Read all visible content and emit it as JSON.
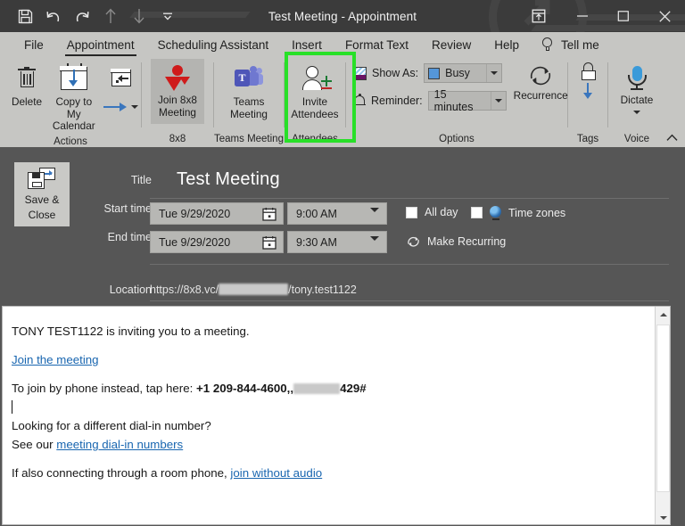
{
  "window": {
    "title": "Test Meeting  -  Appointment",
    "quick_access": [
      {
        "name": "save",
        "icon": "save-icon",
        "enabled": true
      },
      {
        "name": "undo",
        "icon": "undo-icon",
        "enabled": true
      },
      {
        "name": "redo",
        "icon": "redo-icon",
        "enabled": true
      },
      {
        "name": "previous-item",
        "icon": "up-arrow-icon",
        "enabled": false
      },
      {
        "name": "next-item",
        "icon": "down-arrow-icon",
        "enabled": false
      },
      {
        "name": "customize-quick-access-toolbar",
        "icon": "chevron-down-icon",
        "enabled": true
      }
    ],
    "controls": {
      "ribbon_display_options": "ribbon-options-icon",
      "minimize": "minimize-icon",
      "maximize": "maximize-icon",
      "close": "close-icon"
    }
  },
  "tabs": [
    {
      "label": "File",
      "active": false
    },
    {
      "label": "Appointment",
      "active": true
    },
    {
      "label": "Scheduling Assistant",
      "active": false
    },
    {
      "label": "Insert",
      "active": false
    },
    {
      "label": "Format Text",
      "active": false
    },
    {
      "label": "Review",
      "active": false
    },
    {
      "label": "Help",
      "active": false
    }
  ],
  "tell_me": {
    "label": "Tell me",
    "icon": "lightbulb-icon"
  },
  "ribbon": {
    "groups": [
      {
        "label": "Actions",
        "buttons": [
          {
            "label_line1": "Delete",
            "label_line2": "",
            "icon": "trash-icon"
          },
          {
            "label_line1": "Copy to My",
            "label_line2": "Calendar",
            "icon": "calendar-download-icon"
          },
          {
            "label_line1": "",
            "label_line2": "",
            "icon": "forward-calendar-icon"
          }
        ]
      },
      {
        "label": "8x8",
        "highlighted": true,
        "highlight_color": "#28e028",
        "buttons": [
          {
            "label_line1": "Join 8x8",
            "label_line2": "Meeting",
            "icon": "8x8-logo-icon"
          }
        ]
      },
      {
        "label": "Teams Meeting",
        "buttons": [
          {
            "label_line1": "Teams",
            "label_line2": "Meeting",
            "icon": "microsoft-teams-icon",
            "badge": "T"
          }
        ]
      },
      {
        "label": "Attendees",
        "buttons": [
          {
            "label_line1": "Invite",
            "label_line2": "Attendees",
            "icon": "invite-person-icon"
          }
        ]
      },
      {
        "label": "Options",
        "show_as": {
          "label": "Show As:",
          "value": "Busy",
          "icon": "show-as-icon"
        },
        "reminder": {
          "label": "Reminder:",
          "value": "15 minutes",
          "icon": "bell-icon"
        },
        "recurrence": {
          "label": "Recurrence",
          "icon": "recurrence-icon"
        }
      },
      {
        "label": "Tags",
        "icons": [
          "lock-icon",
          "importance-high-icon",
          "importance-low-icon"
        ]
      },
      {
        "label": "Voice",
        "buttons": [
          {
            "label_line1": "Dictate",
            "label_line2": "",
            "icon": "microphone-icon"
          }
        ]
      }
    ],
    "collapse_icon": "chevron-up-icon"
  },
  "form": {
    "save_close": {
      "line1": "Save &",
      "line2": "Close",
      "icon": "save-and-close-icon"
    },
    "title": {
      "label": "Title",
      "value": "Test Meeting"
    },
    "start_time": {
      "label": "Start time",
      "date": "Tue 9/29/2020",
      "time": "9:00 AM",
      "date_icon": "calendar-picker-icon",
      "time_icon": "chevron-down-icon"
    },
    "end_time": {
      "label": "End time",
      "date": "Tue 9/29/2020",
      "time": "9:30 AM",
      "date_icon": "calendar-picker-icon",
      "time_icon": "chevron-down-icon"
    },
    "all_day": {
      "label": "All day",
      "checked": false
    },
    "time_zones": {
      "label": "Time zones",
      "checked": false,
      "icon": "globe-icon"
    },
    "make_recurring": {
      "label": "Make Recurring",
      "icon": "recurrence-icon"
    },
    "location": {
      "label": "Location",
      "prefix": "https://8x8.vc/",
      "redacted": true,
      "suffix": "/tony.test1122"
    }
  },
  "body": {
    "line_invite": "TONY TEST1122 is inviting you to a meeting.",
    "link_join": "Join the meeting",
    "phone_prefix": "To join by phone instead, tap here: ",
    "phone_number": "+1 209-844-4600,,",
    "phone_suffix": "429#",
    "dialin_question": "Looking for a different dial-in number?",
    "dialin_prefix": "See our ",
    "dialin_link": "meeting dial-in numbers",
    "room_prefix": "If also connecting through a room phone, ",
    "room_link": "join without audio"
  },
  "scrollbar": {
    "up_icon": "scroll-up-icon",
    "down_icon": "scroll-down-icon",
    "thumb": "scroll-thumb"
  }
}
